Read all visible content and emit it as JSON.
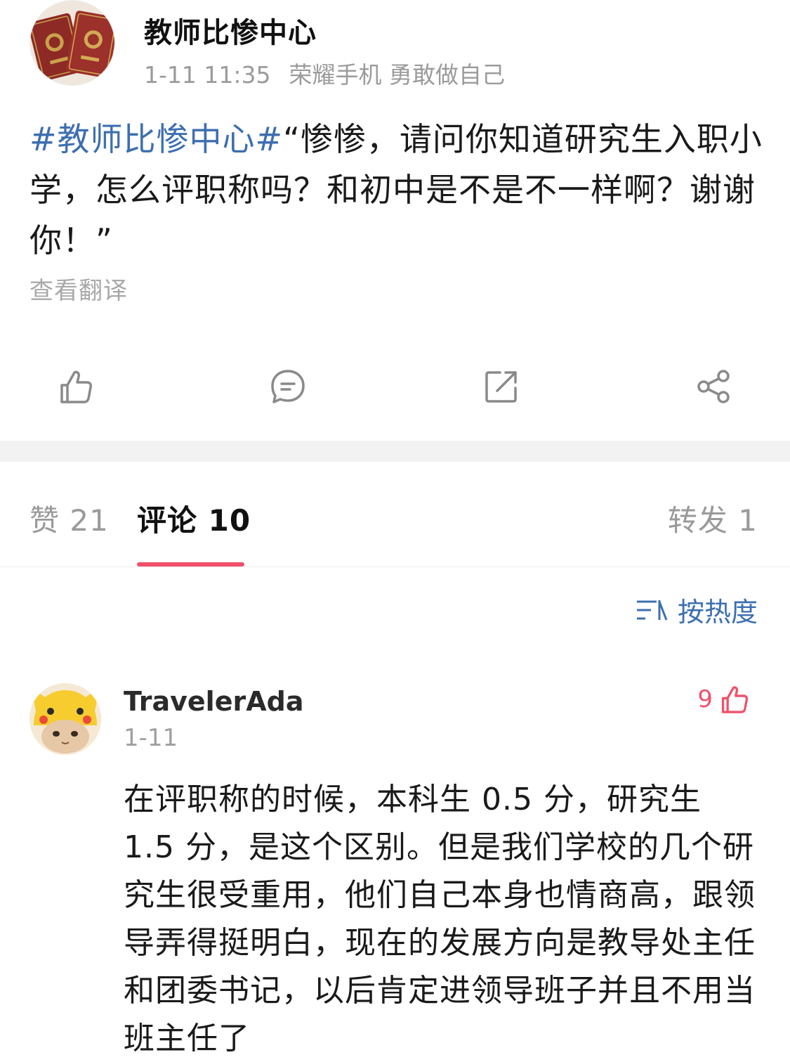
{
  "post": {
    "author": "教师比惨中心",
    "time": "1-11 11:35",
    "device": "荣耀手机 勇敢做自己",
    "hashtag": "#教师比惨中心#",
    "text": "“惨惨，请问你知道研究生入职小学，怎么评职称吗？和初中是不是不一样啊？谢谢你！”",
    "translate_label": "查看翻译"
  },
  "actions": {
    "like_icon": "thumbs-up-icon",
    "comment_icon": "comment-icon",
    "repost_icon": "repost-icon",
    "share_icon": "share-icon"
  },
  "tabs": {
    "likes": "赞 21",
    "comments": "评论 10",
    "reposts": "转发 1"
  },
  "sort": {
    "label": "按热度",
    "icon": "sort-icon"
  },
  "comment": {
    "user": "TravelerAda",
    "date": "1-11",
    "likes": "9",
    "text": "在评职称的时候，本科生 0.5 分，研究生 1.5 分，是这个区别。但是我们学校的几个研究生很受重用，他们自己本身也情商高，跟领导弄得挺明白，现在的发展方向是教导处主任和团委书记，以后肯定进领导班子并且不用当班主任了"
  },
  "colors": {
    "accent": "#f1506a",
    "link": "#3d6fb0",
    "muted": "#9b9b9b"
  }
}
